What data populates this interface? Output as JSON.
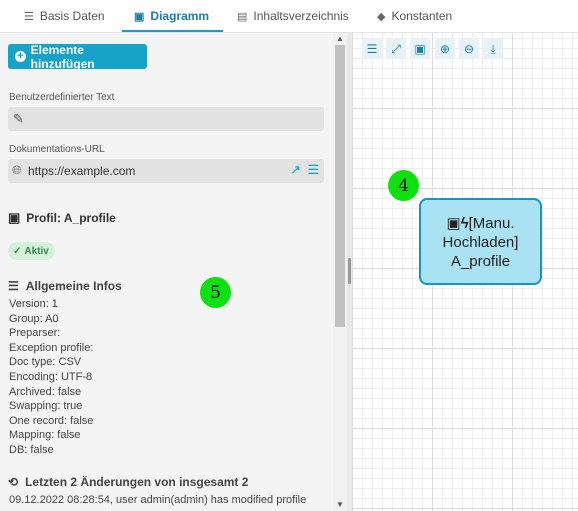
{
  "tabs": [
    {
      "label": "Basis Daten",
      "icon": "list-icon"
    },
    {
      "label": "Diagramm",
      "icon": "diagram-icon",
      "active": true
    },
    {
      "label": "Inhaltsverzeichnis",
      "icon": "toc-icon"
    },
    {
      "label": "Konstanten",
      "icon": "tag-icon"
    }
  ],
  "left": {
    "add_button": "Elemente hinzufügen",
    "custom_text_label": "Benutzerdefinierter Text",
    "custom_text_value": "",
    "doc_url_label": "Dokumentations-URL",
    "doc_url_value": "https://example.com",
    "profile_title": "Profil: A_profile",
    "status_badge": "Aktiv",
    "general_info_title": "Allgemeine Infos",
    "info_lines": [
      "Version: 1",
      "Group: A0",
      "Preparser:",
      "Exception profile:",
      "Doc type: CSV",
      "Encoding: UTF-8",
      "Archived: false",
      "Swapping: true",
      "One record: false",
      "Mapping: false",
      "DB: false"
    ],
    "changes_title": "Letzten 2 Änderungen von insgesamt 2",
    "change_entry": "09.12.2022 08:28:54, user admin(admin) has modified profile"
  },
  "markers": {
    "canvas_marker": "4",
    "panel_marker": "5"
  },
  "node": {
    "line1": "[Manu.",
    "line2": "Hochladen]",
    "line3": "A_profile"
  },
  "colors": {
    "accent": "#17a2c7",
    "node_fill": "#a9e2f2",
    "node_border": "#1a93c3",
    "marker": "#0fe00f",
    "badge_bg": "#d6efd9",
    "badge_text": "#2f8a46"
  }
}
